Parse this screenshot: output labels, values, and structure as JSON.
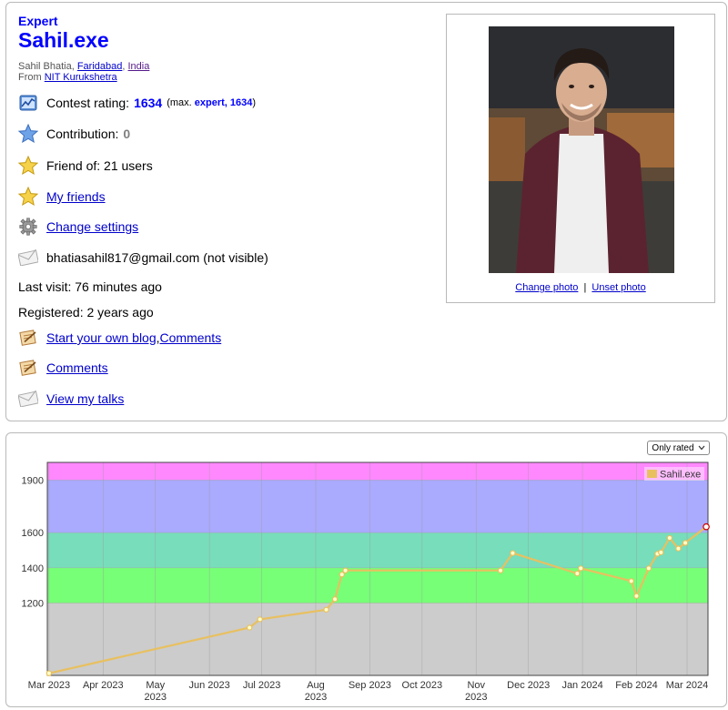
{
  "profile": {
    "rank": "Expert",
    "handle": "Sahil.exe",
    "name": "Sahil Bhatia, ",
    "city": "Faridabad",
    "comma": ", ",
    "country": "India",
    "from_label": "From ",
    "organization": "NIT Kurukshetra",
    "contest_rating_label": "Contest rating:",
    "contest_rating": "1634",
    "max_open": "(max. ",
    "max_rank": "expert, 1634",
    "max_close": ")",
    "contribution_label": "Contribution:",
    "contribution": "0",
    "friend_of": "Friend of: 21 users",
    "my_friends": "My friends",
    "change_settings": "Change settings",
    "email": "bhatiasahil817@gmail.com (not visible)",
    "last_visit": "Last visit: 76 minutes ago",
    "registered": "Registered: 2 years ago",
    "start_blog": "Start your own blog",
    "blog_sep": ", ",
    "comments_inline": "Comments",
    "comments": "Comments",
    "view_talks": "View my talks",
    "change_photo": "Change photo",
    "photo_sep": "|",
    "unset_photo": "Unset photo"
  },
  "icons": {
    "contest_rating": "rating-graph-icon",
    "contribution": "blue-star-icon",
    "friend_of": "gold-star-icon",
    "my_friends": "gold-star-icon",
    "settings": "gear-icon",
    "email": "envelope-icon",
    "blog": "blog-icon",
    "comments": "blog-icon",
    "talks": "envelope-icon"
  },
  "colors": {
    "rank_blue": "#0000ff",
    "link": "#0000cc",
    "line": "#e8c060",
    "point_fill": "#ffffcc",
    "band_newbie": "#cccccc",
    "band_pupil": "#77ff77",
    "band_specialist": "#77ddbb",
    "band_expert": "#aaaaff",
    "band_candidate_master": "#ff88ff"
  },
  "chart_filter": {
    "label": "Only rated",
    "icon": "chevron-down-icon"
  },
  "chart_data": {
    "type": "line",
    "x_tick_labels": [
      [
        "Mar 2023"
      ],
      [
        "Apr 2023"
      ],
      [
        "May",
        "2023"
      ],
      [
        "Jun 2023"
      ],
      [
        "Jul 2023"
      ],
      [
        "Aug",
        "2023"
      ],
      [
        "Sep 2023"
      ],
      [
        "Oct 2023"
      ],
      [
        "Nov",
        "2023"
      ],
      [
        "Dec 2023"
      ],
      [
        "Jan 2024"
      ],
      [
        "Feb 2024"
      ],
      [
        "Mar 2024"
      ]
    ],
    "x_tick_dates": [
      "2023-03-01",
      "2023-04-01",
      "2023-05-01",
      "2023-06-01",
      "2023-07-01",
      "2023-08-01",
      "2023-09-01",
      "2023-10-01",
      "2023-11-01",
      "2023-12-01",
      "2024-01-01",
      "2024-02-01",
      "2024-03-01"
    ],
    "xlim": [
      "2023-02-28",
      "2024-03-13"
    ],
    "y_ticks": [
      1200,
      1400,
      1600,
      1900
    ],
    "ylim": [
      788,
      2000
    ],
    "grid": true,
    "bands": [
      {
        "from": 788,
        "to": 1200,
        "color": "#cccccc"
      },
      {
        "from": 1200,
        "to": 1400,
        "color": "#77ff77"
      },
      {
        "from": 1400,
        "to": 1600,
        "color": "#77ddbb"
      },
      {
        "from": 1600,
        "to": 1900,
        "color": "#aaaaff"
      },
      {
        "from": 1900,
        "to": 2000,
        "color": "#ff88ff"
      }
    ],
    "legend": "top-right",
    "series": [
      {
        "name": "Sahil.exe",
        "points": [
          {
            "x": "2023-03-01",
            "y": 800
          },
          {
            "x": "2023-06-24",
            "y": 1060
          },
          {
            "x": "2023-06-30",
            "y": 1107
          },
          {
            "x": "2023-08-07",
            "y": 1162
          },
          {
            "x": "2023-08-12",
            "y": 1222
          },
          {
            "x": "2023-08-16",
            "y": 1362
          },
          {
            "x": "2023-08-18",
            "y": 1385
          },
          {
            "x": "2023-11-15",
            "y": 1385
          },
          {
            "x": "2023-11-22",
            "y": 1484
          },
          {
            "x": "2023-12-29",
            "y": 1368
          },
          {
            "x": "2023-12-31",
            "y": 1397
          },
          {
            "x": "2024-01-29",
            "y": 1325
          },
          {
            "x": "2024-02-01",
            "y": 1240
          },
          {
            "x": "2024-02-08",
            "y": 1397
          },
          {
            "x": "2024-02-13",
            "y": 1480
          },
          {
            "x": "2024-02-15",
            "y": 1488
          },
          {
            "x": "2024-02-20",
            "y": 1570
          },
          {
            "x": "2024-02-25",
            "y": 1510
          },
          {
            "x": "2024-02-29",
            "y": 1542
          },
          {
            "x": "2024-03-12",
            "y": 1634
          }
        ]
      }
    ]
  }
}
